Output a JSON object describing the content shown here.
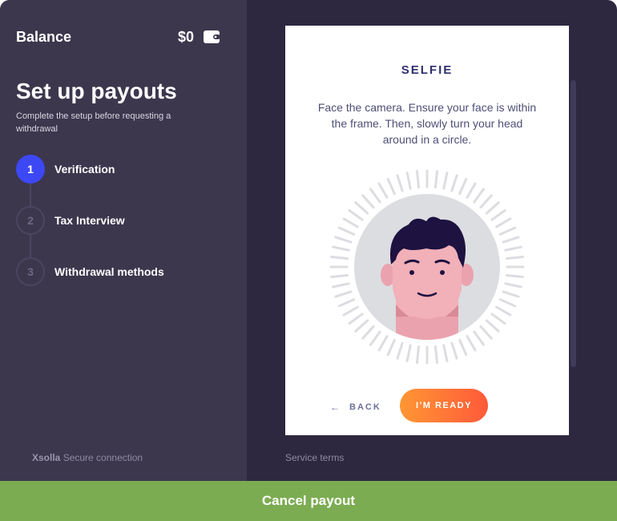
{
  "sidebar": {
    "balance_label": "Balance",
    "balance_amount": "$0",
    "wallet_icon": "wallet-icon",
    "title": "Set up payouts",
    "subtitle": "Complete the setup before requesting a withdrawal",
    "steps": [
      {
        "number": "1",
        "label": "Verification",
        "state": "active"
      },
      {
        "number": "2",
        "label": "Tax Interview",
        "state": "inactive"
      },
      {
        "number": "3",
        "label": "Withdrawal methods",
        "state": "inactive"
      }
    ],
    "footer": {
      "brand": "Xsolla",
      "text": "Secure connection"
    }
  },
  "main": {
    "service_terms": "Service terms",
    "card": {
      "title": "SELFIE",
      "instructions": "Face the camera. Ensure your face is within the frame. Then, slowly turn your head around in a circle.",
      "back_label": "BACK",
      "back_icon": "arrow-left-icon",
      "ready_label": "I'M READY"
    }
  },
  "cancel_label": "Cancel payout",
  "colors": {
    "modal_bg": "#2d2840",
    "sidebar_bg": "#3c374d",
    "active_step": "#3d48f5",
    "ready_gradient_start": "#ff9633",
    "ready_gradient_end": "#ff5a3a",
    "cancel_bar": "#7cac52",
    "card_title": "#2e2f6e"
  }
}
